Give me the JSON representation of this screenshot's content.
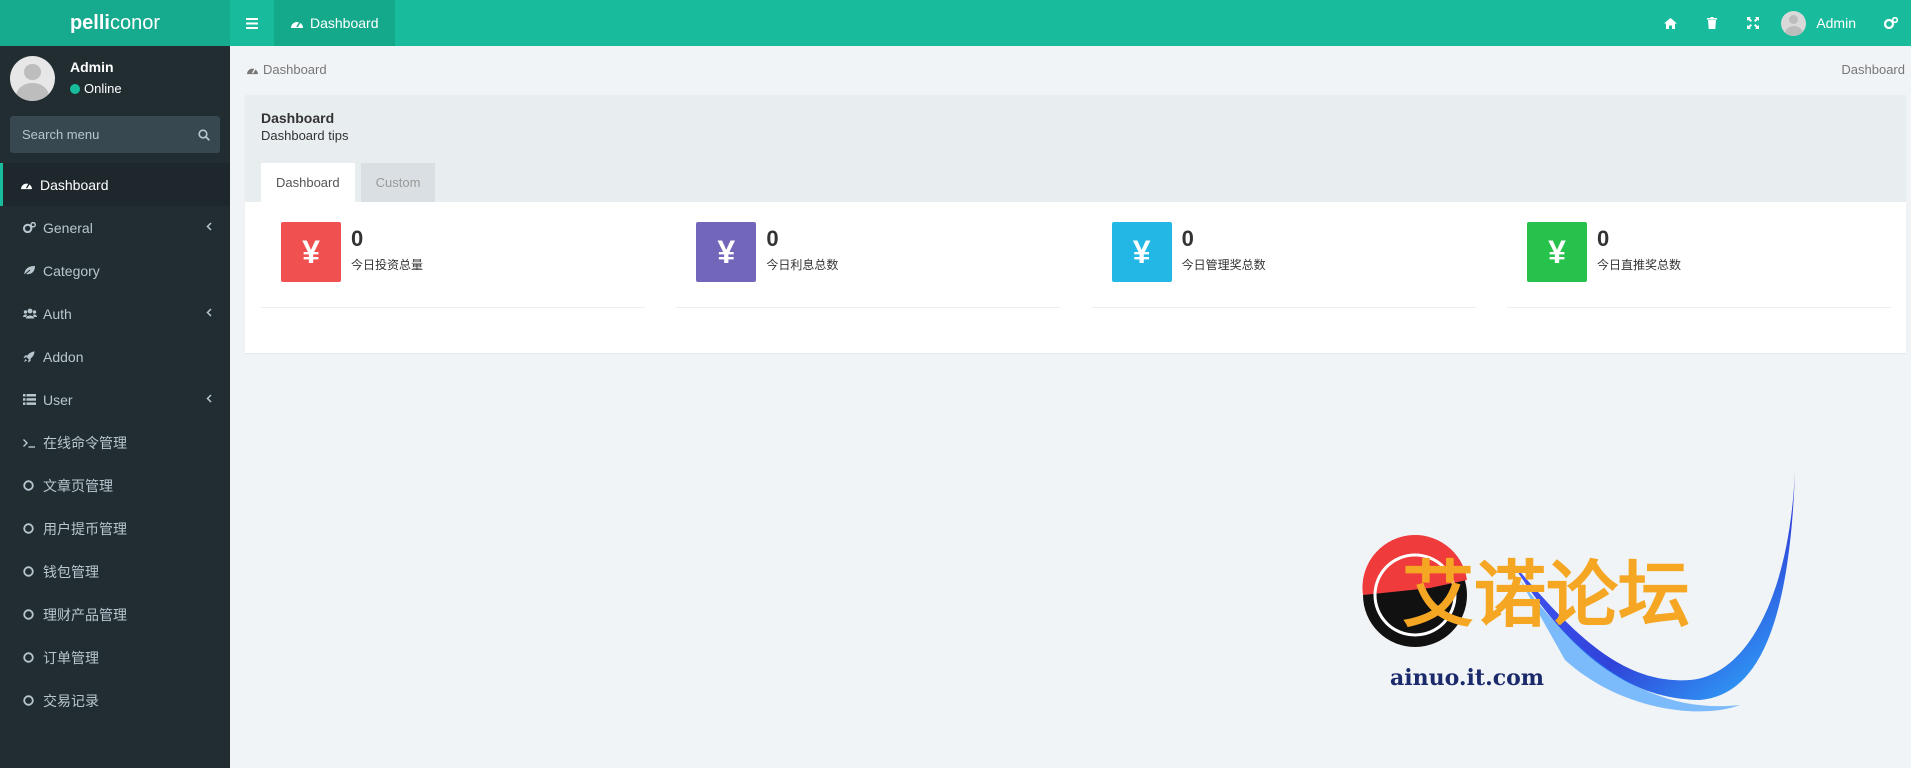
{
  "app": {
    "brand_bold": "pelli",
    "brand_light": "conor"
  },
  "header": {
    "tab_label": "Dashboard",
    "user_name": "Admin",
    "icons": [
      "bars-icon",
      "home-icon",
      "trash-icon",
      "fullscreen-icon",
      "cogs-icon"
    ]
  },
  "sidebar": {
    "user": {
      "name": "Admin",
      "status": "Online",
      "status_color": "#18bc9c"
    },
    "search": {
      "placeholder": "Search menu"
    },
    "items": [
      {
        "label": "Dashboard",
        "icon": "dashboard-icon",
        "active": true
      },
      {
        "label": "General",
        "icon": "cogs-icon",
        "has_children": true
      },
      {
        "label": "Category",
        "icon": "leaf-icon"
      },
      {
        "label": "Auth",
        "icon": "group-icon",
        "has_children": true
      },
      {
        "label": "Addon",
        "icon": "rocket-icon"
      },
      {
        "label": "User",
        "icon": "list-icon",
        "has_children": true
      },
      {
        "label": "在线命令管理",
        "icon": "terminal-icon"
      },
      {
        "label": "文章页管理",
        "icon": "circle-icon"
      },
      {
        "label": "用户提币管理",
        "icon": "circle-icon"
      },
      {
        "label": "钱包管理",
        "icon": "circle-icon"
      },
      {
        "label": "理财产品管理",
        "icon": "circle-icon"
      },
      {
        "label": "订单管理",
        "icon": "circle-icon"
      },
      {
        "label": "交易记录",
        "icon": "circle-icon"
      }
    ]
  },
  "breadcrumb": {
    "left": "Dashboard",
    "right": "Dashboard"
  },
  "panel": {
    "title": "Dashboard",
    "tips": "Dashboard tips",
    "tabs": [
      {
        "label": "Dashboard",
        "active": true
      },
      {
        "label": "Custom",
        "active": false
      }
    ]
  },
  "stats": [
    {
      "value": "0",
      "label": "今日投资总量",
      "symbol": "¥",
      "color": "#f05050"
    },
    {
      "value": "0",
      "label": "今日利息总数",
      "symbol": "¥",
      "color": "#7266ba"
    },
    {
      "value": "0",
      "label": "今日管理奖总数",
      "symbol": "¥",
      "color": "#23b7e5"
    },
    {
      "value": "0",
      "label": "今日直推奖总数",
      "symbol": "¥",
      "color": "#27c24c"
    }
  ],
  "watermark": {
    "title": "艾诺论坛",
    "site": "ainuo.it.com"
  },
  "colors": {
    "header": "#18bc9c",
    "sidebar": "#222d32",
    "accent": "#18bc9c"
  }
}
